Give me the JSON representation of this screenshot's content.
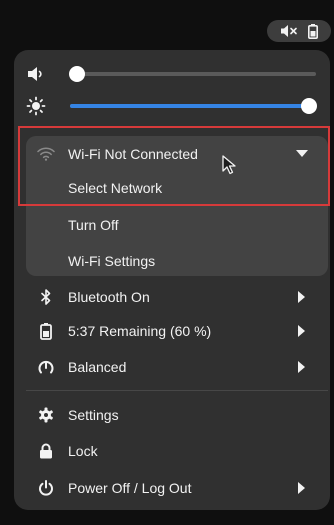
{
  "sliders": {
    "volume": {
      "icon": "volume-icon",
      "value_fraction": 0.03
    },
    "brightness": {
      "icon": "brightness-icon",
      "value_fraction": 0.97
    }
  },
  "wifi": {
    "icon": "wifi-icon",
    "label": "Wi-Fi Not Connected",
    "items": [
      {
        "label": "Select Network"
      },
      {
        "label": "Turn Off"
      },
      {
        "label": "Wi-Fi Settings"
      }
    ]
  },
  "menu": {
    "bluetooth": {
      "icon": "bluetooth-icon",
      "label": "Bluetooth On"
    },
    "battery": {
      "icon": "battery-icon",
      "label": "5:37 Remaining (60 %)"
    },
    "power_mode": {
      "icon": "power-mode-icon",
      "label": "Balanced"
    },
    "settings": {
      "icon": "gear-icon",
      "label": "Settings"
    },
    "lock": {
      "icon": "lock-icon",
      "label": "Lock"
    },
    "power_off": {
      "icon": "power-icon",
      "label": "Power Off / Log Out"
    }
  },
  "tray": {
    "icons": [
      "muted-volume-icon",
      "battery-icon"
    ]
  },
  "colors": {
    "accent": "#3584e4",
    "menu_bg": "#303030",
    "highlight_box": "#d63a3a"
  }
}
